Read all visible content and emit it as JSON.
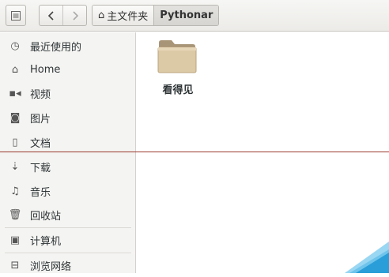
{
  "pathbar": {
    "home_label": "主文件夹",
    "current_label": "Pythonar"
  },
  "sidebar": {
    "items": [
      {
        "label": "最近使用的",
        "icon": "clock-icon"
      },
      {
        "label": "Home",
        "icon": "home-icon"
      },
      {
        "label": "视频",
        "icon": "video-icon"
      },
      {
        "label": "图片",
        "icon": "camera-icon"
      },
      {
        "label": "文档",
        "icon": "document-icon"
      },
      {
        "label": "下载",
        "icon": "download-icon"
      },
      {
        "label": "音乐",
        "icon": "music-icon"
      },
      {
        "label": "回收站",
        "icon": "trash-icon"
      },
      {
        "label": "计算机",
        "icon": "computer-icon"
      },
      {
        "label": "浏览网络",
        "icon": "network-icon"
      }
    ]
  },
  "files": [
    {
      "name": "看得见",
      "icon": "folder-icon"
    }
  ],
  "colors": {
    "folder": "#d9c8a6",
    "accent_line": "#9b3a2e",
    "corner_accent": "#2a9ed8"
  }
}
